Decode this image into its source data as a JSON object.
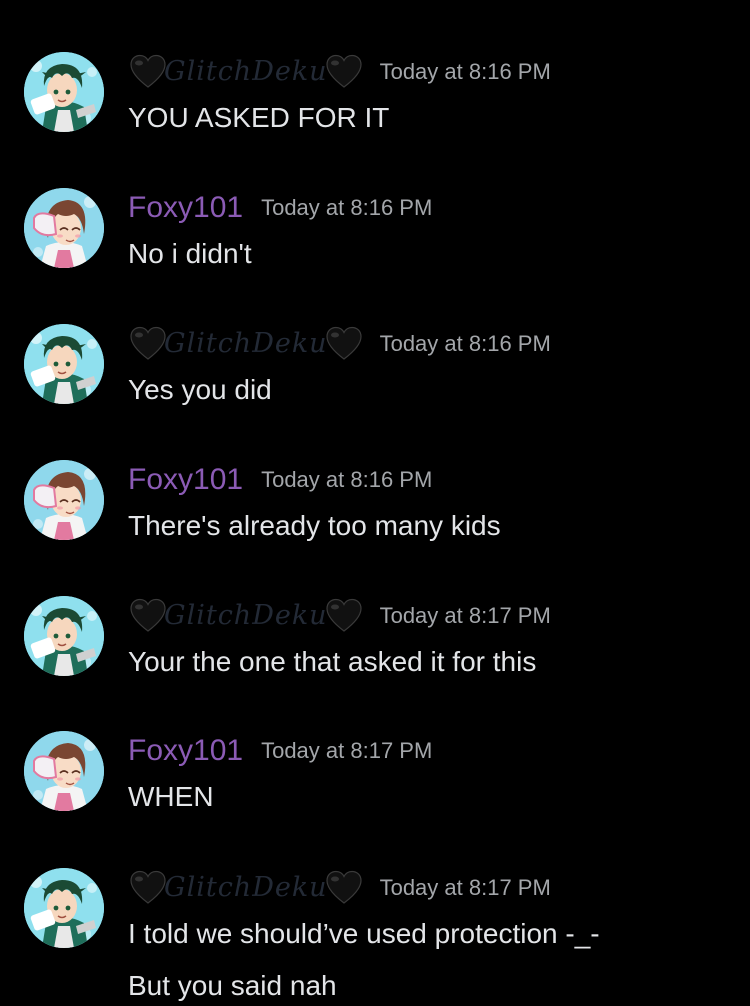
{
  "users": {
    "deku": {
      "name": "GlitchDeku",
      "name_color": "#232a36",
      "avatar_icon": "deku-avatar-icon",
      "decoration_icon": "black-heart-icon"
    },
    "foxy": {
      "name": "Foxy101",
      "name_color": "#8b5bb5",
      "avatar_icon": "uraraka-avatar-icon"
    }
  },
  "messages": [
    {
      "author": "deku",
      "name": "GlitchDeku",
      "timestamp": "Today at 8:16 PM",
      "lines": [
        "YOU ASKED FOR IT"
      ]
    },
    {
      "author": "foxy",
      "name": "Foxy101",
      "timestamp": "Today at 8:16 PM",
      "lines": [
        "No i didn't"
      ]
    },
    {
      "author": "deku",
      "name": "GlitchDeku",
      "timestamp": "Today at 8:16 PM",
      "lines": [
        "Yes you did"
      ]
    },
    {
      "author": "foxy",
      "name": "Foxy101",
      "timestamp": "Today at 8:16 PM",
      "lines": [
        "There's already too many kids"
      ]
    },
    {
      "author": "deku",
      "name": "GlitchDeku",
      "timestamp": "Today at 8:17 PM",
      "lines": [
        "Your the one that asked it for this"
      ]
    },
    {
      "author": "foxy",
      "name": "Foxy101",
      "timestamp": "Today at 8:17 PM",
      "lines": [
        "WHEN"
      ]
    },
    {
      "author": "deku",
      "name": "GlitchDeku",
      "timestamp": "Today at 8:17 PM",
      "lines": [
        "I told we should’ve used protection -_-",
        "But you said nah"
      ]
    }
  ],
  "colors": {
    "background": "#000000",
    "message_text": "#e3e5e8",
    "timestamp": "#a3a6aa"
  }
}
